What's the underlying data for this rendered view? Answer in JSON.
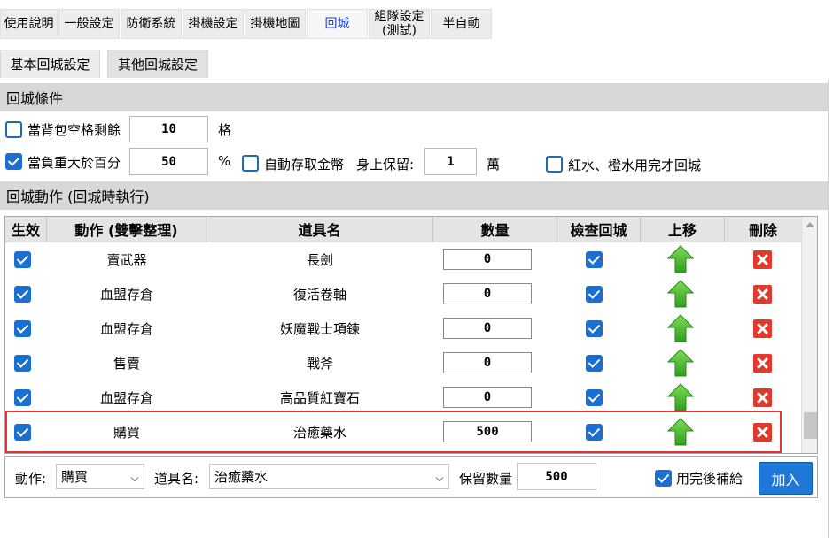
{
  "tabs": [
    {
      "label": "使用說明"
    },
    {
      "label": "一般設定"
    },
    {
      "label": "防衛系統"
    },
    {
      "label": "掛機設定"
    },
    {
      "label": "掛機地圖"
    },
    {
      "label": "回城"
    },
    {
      "label": "組隊設定\n(測試)"
    },
    {
      "label": "半自動"
    }
  ],
  "subtabs": [
    {
      "label": "基本回城設定"
    },
    {
      "label": "其他回城設定"
    }
  ],
  "conditions": {
    "title": "回城條件",
    "bag_label": "當背包空格剩餘",
    "bag_value": "10",
    "bag_unit": "格",
    "weight_label": "當負重大於百分",
    "weight_value": "50",
    "weight_unit": "%",
    "auto_gold_label": "自動存取金幣",
    "keep_label": "身上保留:",
    "keep_value": "1",
    "keep_unit": "萬",
    "potion_label": "紅水、橙水用完才回城"
  },
  "actions": {
    "title": "回城動作 (回城時執行)",
    "headers": {
      "enabled": "生效",
      "action": "動作 (雙擊整理)",
      "item": "道具名",
      "qty": "數量",
      "check": "檢查回城",
      "up": "上移",
      "del": "刪除"
    },
    "rows": [
      {
        "action": "賣武器",
        "item": "長劍",
        "qty": "0"
      },
      {
        "action": "血盟存倉",
        "item": "復活卷軸",
        "qty": "0"
      },
      {
        "action": "血盟存倉",
        "item": "妖魔戰士項鍊",
        "qty": "0"
      },
      {
        "action": "售賣",
        "item": "戰斧",
        "qty": "0"
      },
      {
        "action": "血盟存倉",
        "item": "高品質紅寶石",
        "qty": "0"
      },
      {
        "action": "購買",
        "item": "治癒藥水",
        "qty": "500"
      }
    ]
  },
  "editor": {
    "action_label": "動作:",
    "action_value": "購買",
    "item_label": "道具名:",
    "item_value": "治癒藥水",
    "keep_qty_label": "保留數量",
    "keep_qty_value": "500",
    "refill_label": "用完後補給",
    "add_label": "加入"
  }
}
